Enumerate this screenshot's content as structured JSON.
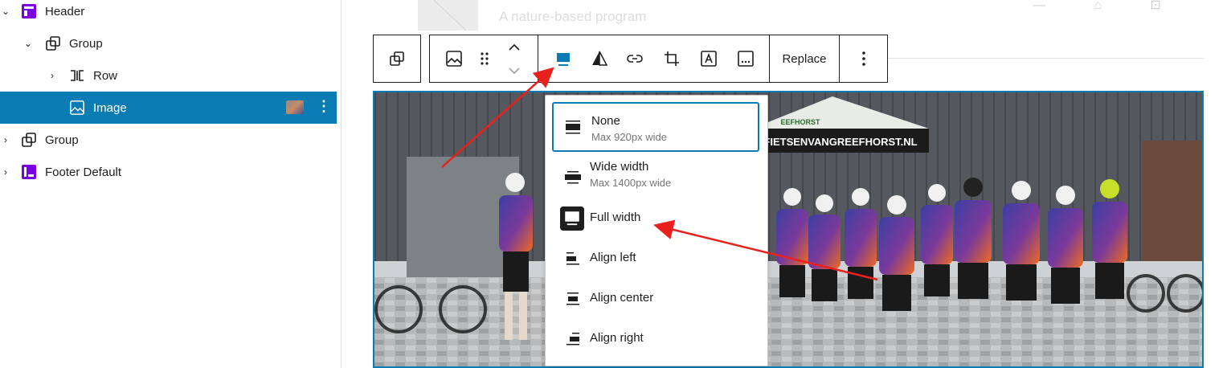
{
  "list_view": {
    "items": [
      {
        "label": "Header",
        "icon": "template-part-icon"
      },
      {
        "label": "Group",
        "icon": "group-icon"
      },
      {
        "label": "Row",
        "icon": "row-icon"
      },
      {
        "label": "Image",
        "icon": "image-icon"
      },
      {
        "label": "Group",
        "icon": "group-icon"
      },
      {
        "label": "Footer Default",
        "icon": "template-part-icon"
      }
    ]
  },
  "background_header": {
    "tagline": "A nature-based program"
  },
  "toolbar": {
    "replace_label": "Replace"
  },
  "alignment_menu": {
    "options": [
      {
        "label": "None",
        "sublabel": "Max 920px wide"
      },
      {
        "label": "Wide width",
        "sublabel": "Max 1400px wide"
      },
      {
        "label": "Full width",
        "sublabel": ""
      },
      {
        "label": "Align left",
        "sublabel": ""
      },
      {
        "label": "Align center",
        "sublabel": ""
      },
      {
        "label": "Align right",
        "sublabel": ""
      }
    ]
  },
  "photo": {
    "banner_text": "FIETSENVANGREEFHORST.NL",
    "tent_text": "EEFHORST"
  },
  "colors": {
    "accent": "#0a7cb3",
    "template_part": "#7a00df",
    "annotation_arrow": "#e8201e"
  }
}
